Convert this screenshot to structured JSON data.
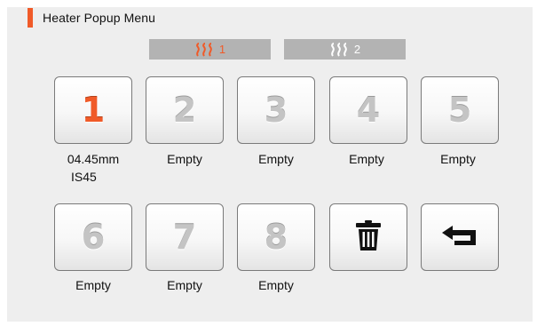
{
  "header": {
    "title": "Heater Popup Menu"
  },
  "heater_tabs": [
    {
      "label": "1",
      "icon": "heat-waves-icon",
      "color": "#f05a28",
      "active": true
    },
    {
      "label": "2",
      "icon": "heat-waves-icon",
      "color": "#ffffff",
      "active": false
    }
  ],
  "slots": [
    {
      "number": "1",
      "line1": "04.45mm",
      "line2": "IS45",
      "active": true
    },
    {
      "number": "2",
      "line1": "Empty"
    },
    {
      "number": "3",
      "line1": "Empty"
    },
    {
      "number": "4",
      "line1": "Empty"
    },
    {
      "number": "5",
      "line1": "Empty"
    },
    {
      "number": "6",
      "line1": "Empty"
    },
    {
      "number": "7",
      "line1": "Empty"
    },
    {
      "number": "8",
      "line1": "Empty"
    }
  ],
  "actions": {
    "delete_icon": "trash-icon",
    "back_icon": "return-arrow-icon"
  },
  "colors": {
    "accent": "#f05a28",
    "panel": "#eeeeee",
    "tab_bg": "#b3b3b3"
  }
}
